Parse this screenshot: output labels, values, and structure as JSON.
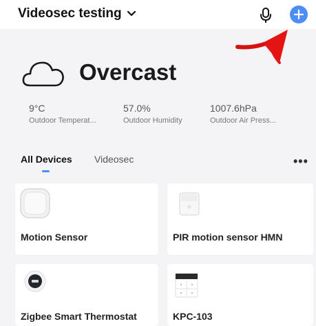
{
  "header": {
    "home_name": "Videosec testing",
    "icons": [
      "chevron-down-icon",
      "microphone-icon",
      "plus-icon"
    ],
    "accent_color": "#4c8df6"
  },
  "weather": {
    "condition": "Overcast",
    "icon": "cloud-icon",
    "stats": [
      {
        "value": "9°C",
        "label": "Outdoor Temperat..."
      },
      {
        "value": "57.0%",
        "label": "Outdoor Humidity"
      },
      {
        "value": "1007.6hPa",
        "label": "Outdoor Air Press..."
      }
    ]
  },
  "tabs": [
    {
      "label": "All Devices",
      "active": true
    },
    {
      "label": "Videosec",
      "active": false
    }
  ],
  "more_label": "•••",
  "devices": [
    {
      "name": "Motion Sensor",
      "icon": "motion-sensor-icon"
    },
    {
      "name": "PIR motion sensor HMN",
      "icon": "pir-sensor-icon"
    },
    {
      "name": "Zigbee Smart Thermostat",
      "icon": "thermostat-icon"
    },
    {
      "name": "KPC-103",
      "icon": "switch-panel-icon"
    }
  ],
  "annotation": {
    "arrow_color": "#e01010"
  }
}
